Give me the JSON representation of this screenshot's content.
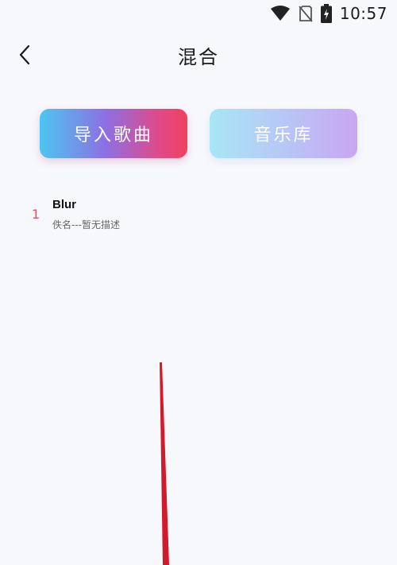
{
  "status_bar": {
    "time": "10:57",
    "icons": [
      "wifi-icon",
      "no-sim-icon",
      "battery-charging-icon"
    ]
  },
  "header": {
    "title": "混合",
    "back_icon": "chevron-left-icon"
  },
  "actions": {
    "import_label": "导入歌曲",
    "library_label": "音乐库"
  },
  "songs": [
    {
      "index": "1",
      "title": "Blur",
      "subtitle": "佚名---暂无描述"
    }
  ],
  "colors": {
    "accent_red": "#f0415f",
    "accent_blue": "#4cc6f0",
    "index_color": "#e84a5f",
    "background": "#f7f8fc"
  }
}
